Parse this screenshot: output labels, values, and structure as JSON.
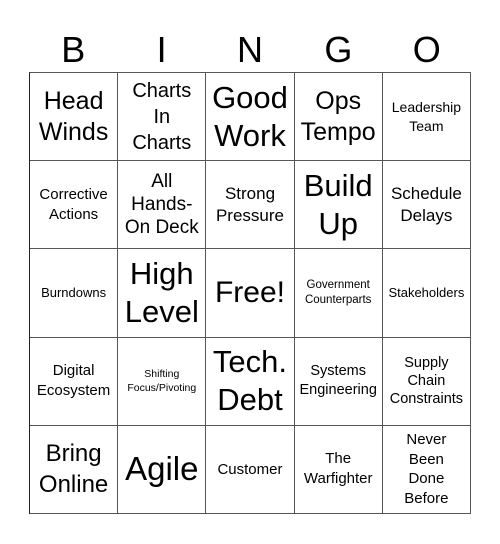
{
  "header": {
    "letters": [
      "B",
      "I",
      "N",
      "G",
      "O"
    ]
  },
  "card": {
    "rows": [
      [
        {
          "text": "Head Winds",
          "size": "l"
        },
        {
          "text": "Charts In Charts",
          "size": "m"
        },
        {
          "text": "Good Work",
          "size": "xl"
        },
        {
          "text": "Ops Tempo",
          "size": "l"
        },
        {
          "text": "Leadership Team",
          "size": "s"
        }
      ],
      [
        {
          "text": "Corrective Actions",
          "size": "n"
        },
        {
          "text": "All Hands-On Deck",
          "size": "m"
        },
        {
          "text": "Strong Pressure",
          "size": "m2"
        },
        {
          "text": "Build Up",
          "size": "xl"
        },
        {
          "text": "Schedule Delays",
          "size": "m2"
        }
      ],
      [
        {
          "text": "Burndowns",
          "size": "xs"
        },
        {
          "text": "High Level",
          "size": "xl"
        },
        {
          "text": "Free!",
          "size": "free"
        },
        {
          "text": "Government Counterparts",
          "size": "xxs2"
        },
        {
          "text": "Stakeholders",
          "size": "xs"
        }
      ],
      [
        {
          "text": "Digital Ecosystem",
          "size": "n"
        },
        {
          "text": "Shifting Focus/Pivoting",
          "size": "xxs"
        },
        {
          "text": "Tech. Debt",
          "size": "xl"
        },
        {
          "text": "Systems Engineering",
          "size": "n2"
        },
        {
          "text": "Supply Chain Constraints",
          "size": "n2"
        }
      ],
      [
        {
          "text": "Bring Online",
          "size": "l"
        },
        {
          "text": "Agile",
          "size": "xl"
        },
        {
          "text": "Customer",
          "size": "n"
        },
        {
          "text": "The Warfighter",
          "size": "n"
        },
        {
          "text": "Never Been Done Before",
          "size": "n"
        }
      ]
    ]
  }
}
